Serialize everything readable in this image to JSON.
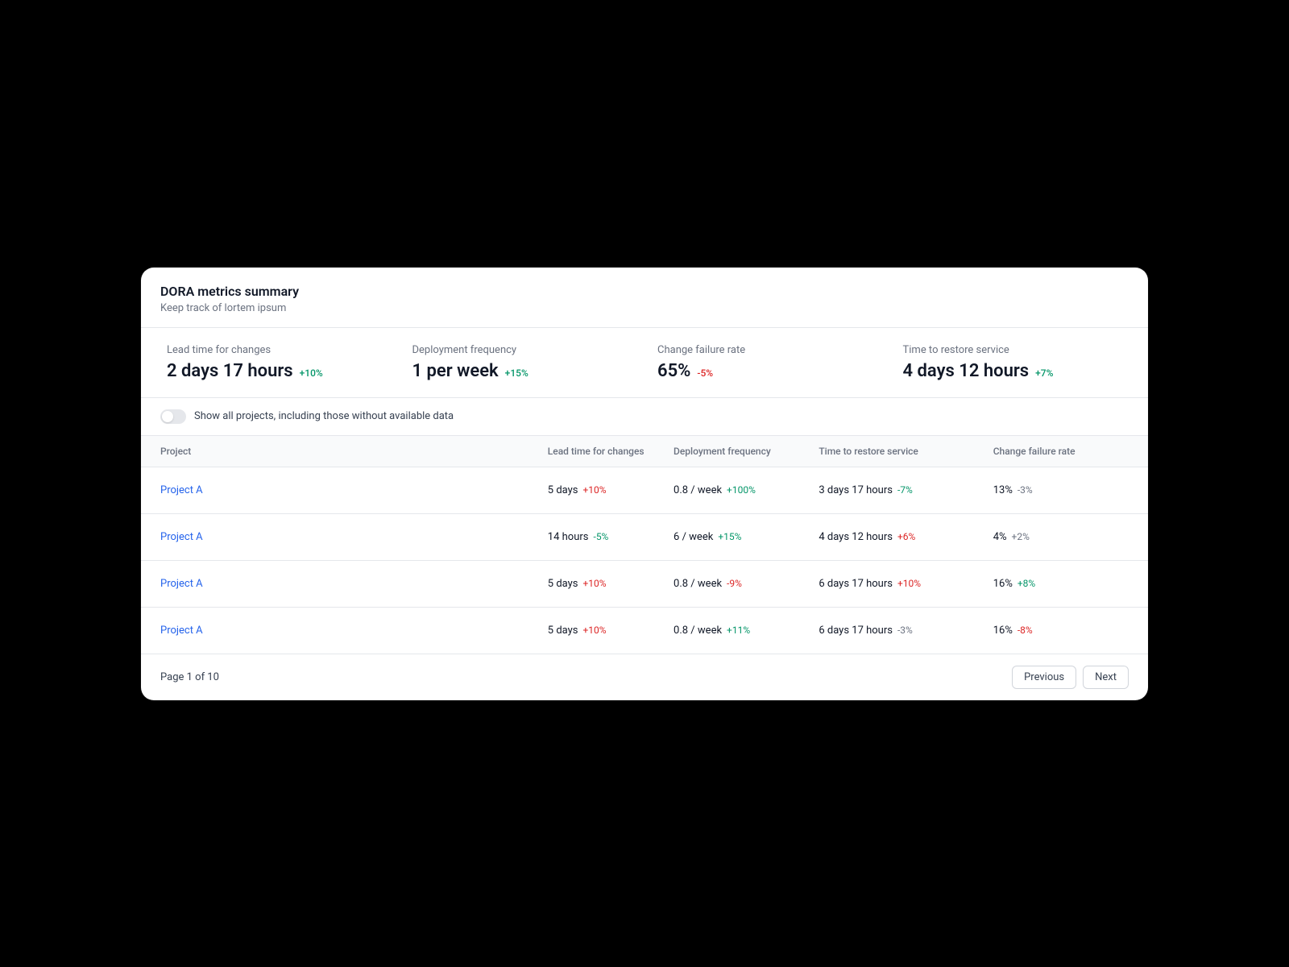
{
  "header": {
    "title": "DORA metrics summary",
    "subtitle": "Keep track of lortem ipsum"
  },
  "metrics": [
    {
      "label": "Lead time for changes",
      "value": "2 days 17 hours",
      "delta": "+10%",
      "trend": "positive"
    },
    {
      "label": "Deployment frequency",
      "value": "1 per week",
      "delta": "+15%",
      "trend": "positive"
    },
    {
      "label": "Change failure rate",
      "value": "65%",
      "delta": "-5%",
      "trend": "negative"
    },
    {
      "label": "Time to restore service",
      "value": "4 days 12 hours",
      "delta": "+7%",
      "trend": "positive"
    }
  ],
  "toggle": {
    "label": "Show all projects, including those without available data",
    "on": false
  },
  "columns": {
    "project": "Project",
    "lead": "Lead time for changes",
    "deploy": "Deployment frequency",
    "restore": "Time to restore service",
    "failure": "Change failure rate"
  },
  "rows": [
    {
      "project": "Project A",
      "lead": {
        "value": "5 days",
        "delta": "+10%",
        "trend": "negative"
      },
      "deploy": {
        "value": "0.8 / week",
        "delta": "+100%",
        "trend": "positive"
      },
      "restore": {
        "value": "3 days 17 hours",
        "delta": "-7%",
        "trend": "positive"
      },
      "failure": {
        "value": "13%",
        "delta": "-3%",
        "trend": "neutral"
      }
    },
    {
      "project": "Project A",
      "lead": {
        "value": "14 hours",
        "delta": "-5%",
        "trend": "positive"
      },
      "deploy": {
        "value": "6 / week",
        "delta": "+15%",
        "trend": "positive"
      },
      "restore": {
        "value": "4 days 12 hours",
        "delta": "+6%",
        "trend": "negative"
      },
      "failure": {
        "value": "4%",
        "delta": "+2%",
        "trend": "neutral"
      }
    },
    {
      "project": "Project A",
      "lead": {
        "value": "5 days",
        "delta": "+10%",
        "trend": "negative"
      },
      "deploy": {
        "value": "0.8 / week",
        "delta": "-9%",
        "trend": "negative"
      },
      "restore": {
        "value": "6 days 17 hours",
        "delta": "+10%",
        "trend": "negative"
      },
      "failure": {
        "value": "16%",
        "delta": "+8%",
        "trend": "positive"
      }
    },
    {
      "project": "Project A",
      "lead": {
        "value": "5 days",
        "delta": "+10%",
        "trend": "negative"
      },
      "deploy": {
        "value": "0.8 / week",
        "delta": "+11%",
        "trend": "positive"
      },
      "restore": {
        "value": "6 days 17 hours",
        "delta": "-3%",
        "trend": "neutral"
      },
      "failure": {
        "value": "16%",
        "delta": "-8%",
        "trend": "negative"
      }
    }
  ],
  "pagination": {
    "text": "Page 1 of 10",
    "previous": "Previous",
    "next": "Next"
  }
}
